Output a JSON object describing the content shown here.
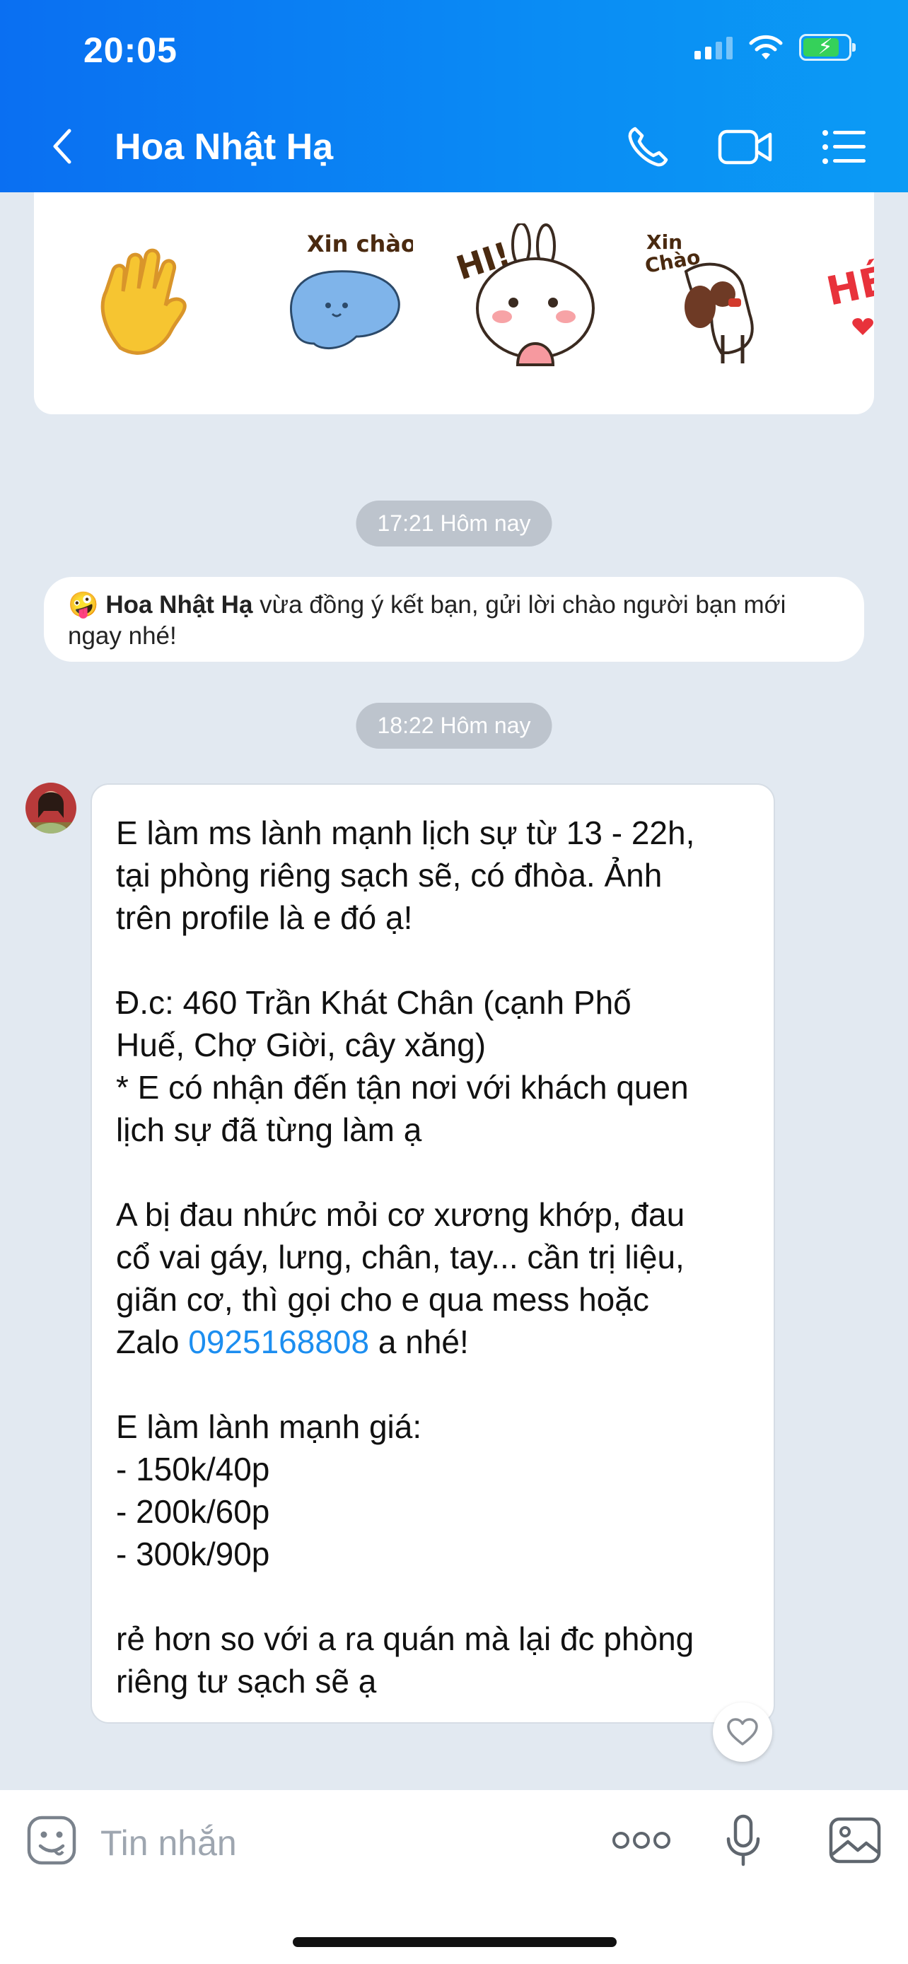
{
  "status_bar": {
    "time": "20:05"
  },
  "header": {
    "title": "Hoa Nhật Hạ",
    "icons": [
      "back-icon",
      "phone-icon",
      "video-call-icon",
      "menu-icon"
    ]
  },
  "stickers": [
    {
      "name": "wave-hand-sticker",
      "label": ""
    },
    {
      "name": "blue-cat-sticker",
      "label": "Xin chào"
    },
    {
      "name": "bunny-hi-sticker",
      "label": "HI!"
    },
    {
      "name": "dog-sticker",
      "label": "Xin\nChào"
    },
    {
      "name": "partial-sticker",
      "label": "HÉ"
    }
  ],
  "timestamps": {
    "first": "17:21 Hôm nay",
    "second": "18:22 Hôm nay"
  },
  "notice": {
    "emoji": "🤪",
    "name": "Hoa Nhật Hạ",
    "text_line1": " vừa đồng ý kết bạn, gửi lời chào người bạn mới",
    "text_line2": "ngay nhé!"
  },
  "message": {
    "lines": [
      "E làm ms lành mạnh lịch sự từ 13 - 22h,",
      "tại phòng riêng sạch sẽ, có đhòa. Ảnh",
      "trên profile là e đó ạ!",
      "",
      "Đ.c: 460 Trần Khát Chân (cạnh Phố",
      "Huế, Chợ Giời, cây xăng)",
      "* E có nhận đến tận nơi với khách quen",
      "lịch sự đã từng làm ạ",
      "",
      "A bị đau nhức mỏi cơ xương khớp, đau",
      "cổ vai gáy, lưng, chân, tay... cần trị liệu,",
      "giãn cơ, thì gọi cho e qua mess hoặc"
    ],
    "zalo_prefix": "Zalo ",
    "phone": "0925168808",
    "zalo_suffix": " a nhé!",
    "lines2": [
      "",
      "E làm lành mạnh giá:",
      "- 150k/40p",
      "- 200k/60p",
      "- 300k/90p",
      "",
      "rẻ hơn so với a ra quán mà lại đc phòng",
      "riêng tư sạch sẽ ạ"
    ]
  },
  "input": {
    "placeholder": "Tin nhắn",
    "icons": [
      "emoji-icon",
      "more-icon",
      "microphone-icon",
      "image-icon"
    ]
  },
  "colors": {
    "header_start": "#0a6ff2",
    "header_end": "#0b9bf5",
    "chat_background": "#e2e9f1",
    "link": "#1c8ef0",
    "time_pill": "#bdc4cd"
  }
}
